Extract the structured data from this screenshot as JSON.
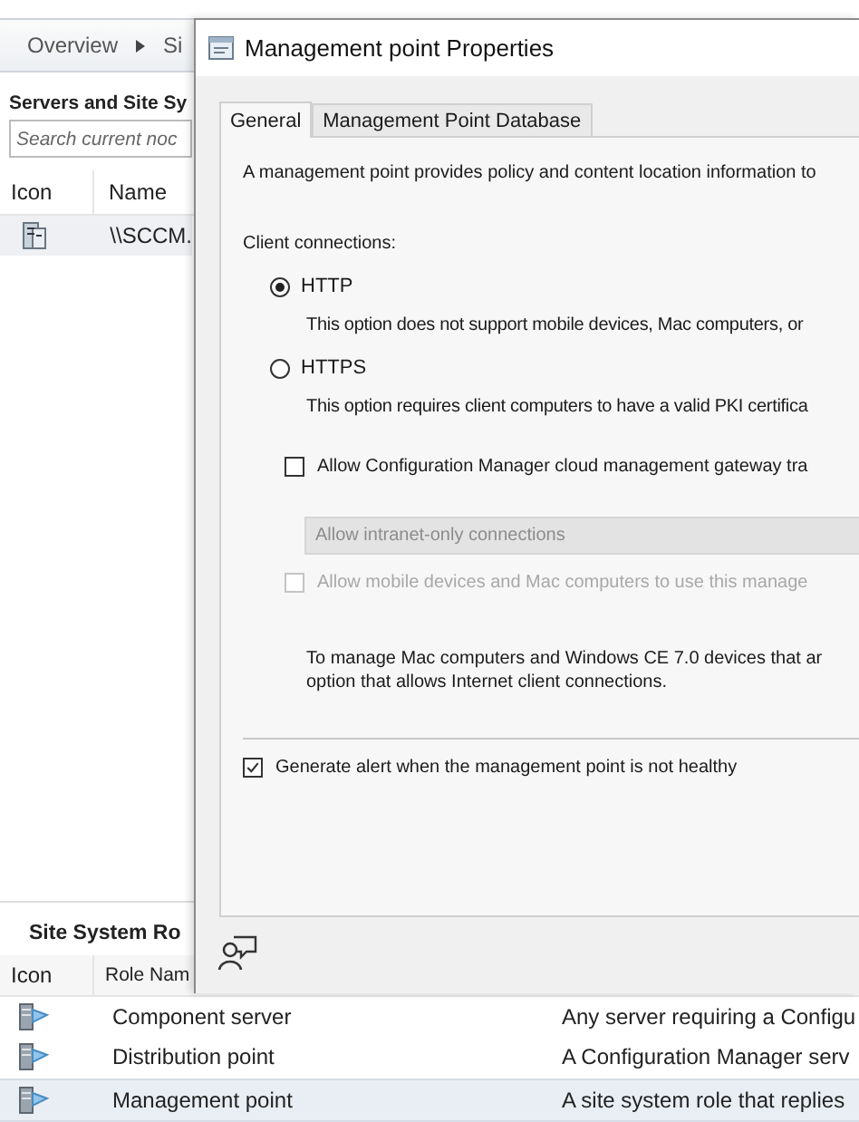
{
  "console": {
    "breadcrumb": [
      "Overview",
      "Si"
    ],
    "servers_pane": {
      "title": "Servers and Site Sy",
      "search": {
        "placeholder": "Search current noc"
      },
      "columns": [
        "Icon",
        "Name"
      ],
      "rows": [
        {
          "name": "\\\\SCCM.",
          "selected": true
        }
      ]
    },
    "roles_pane": {
      "title": "Site System Ro",
      "columns": [
        "Icon",
        "Role Nam"
      ],
      "rows": [
        {
          "name": "Component server",
          "description": "Any server requiring a Configu",
          "selected": false
        },
        {
          "name": "Distribution point",
          "description": "A Configuration Manager serv",
          "selected": false
        },
        {
          "name": "Management point",
          "description": "A site system role that replies",
          "selected": true
        }
      ]
    }
  },
  "dialog": {
    "title": "Management point Properties",
    "tabs": [
      {
        "label": "General",
        "selected": true
      },
      {
        "label": "Management Point Database",
        "selected": false
      }
    ],
    "intro": "A management point provides policy and content location information to",
    "client_connections_label": "Client connections:",
    "options": [
      {
        "label": "HTTP",
        "selected": true,
        "note": "This option does not support mobile devices, Mac computers, or"
      },
      {
        "label": "HTTPS",
        "selected": false,
        "note": "This option requires client computers to have a valid PKI certifica"
      }
    ],
    "cmg_checkbox": {
      "label": "Allow Configuration Manager cloud management gateway tra",
      "checked": false,
      "disabled": false
    },
    "connections_dropdown": {
      "value": "Allow intranet-only connections",
      "disabled": true
    },
    "mobile_checkbox": {
      "label": "Allow mobile devices and Mac computers to use this manage",
      "checked": false,
      "disabled": true
    },
    "mac_note": "To manage Mac computers and Windows CE 7.0 devices that ar\noption that allows Internet client connections.",
    "alert_checkbox": {
      "label": "Generate alert when the management point is not healthy",
      "checked": true,
      "disabled": false
    }
  }
}
